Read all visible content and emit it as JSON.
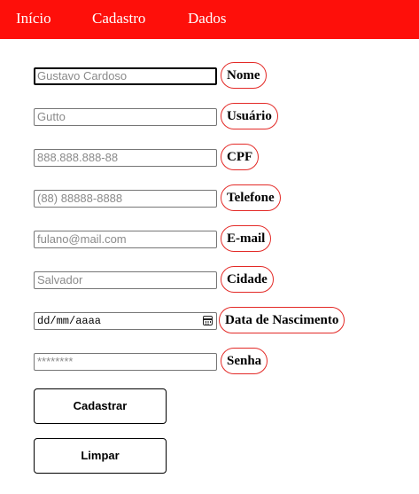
{
  "nav": {
    "items": [
      {
        "label": "Início"
      },
      {
        "label": "Cadastro"
      },
      {
        "label": "Dados"
      }
    ]
  },
  "form": {
    "fields": [
      {
        "label": "Nome",
        "placeholder": "Gustavo Cardoso",
        "state": "focused"
      },
      {
        "label": "Usuário",
        "placeholder": "Gutto"
      },
      {
        "label": "CPF",
        "placeholder": "888.888.888-88"
      },
      {
        "label": "Telefone",
        "placeholder": "(88) 88888-8888"
      },
      {
        "label": "E-mail",
        "placeholder": "fulano@mail.com"
      },
      {
        "label": "Cidade",
        "placeholder": "Salvador"
      },
      {
        "label": "Data de Nascimento",
        "placeholder": "dd/mm/aaaa",
        "icon": "calendar-icon"
      },
      {
        "label": "Senha",
        "placeholder": "********"
      }
    ],
    "buttons": {
      "submit_label": "Cadastrar",
      "reset_label": "Limpar"
    }
  },
  "colors": {
    "navbar_bg": "#fe0f0a",
    "label_border": "#e32a27",
    "input_border": "#767676"
  }
}
